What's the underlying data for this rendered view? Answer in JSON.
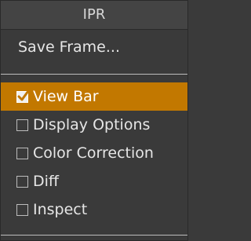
{
  "menu": {
    "title": "IPR",
    "action": "Save Frame...",
    "items": [
      {
        "label": "View Bar",
        "checked": true,
        "highlighted": true
      },
      {
        "label": "Display Options",
        "checked": false,
        "highlighted": false
      },
      {
        "label": "Color Correction",
        "checked": false,
        "highlighted": false
      },
      {
        "label": "Diff",
        "checked": false,
        "highlighted": false
      },
      {
        "label": "Inspect",
        "checked": false,
        "highlighted": false
      }
    ]
  },
  "colors": {
    "background": "#3a3a3a",
    "highlight": "#c27800",
    "text": "#e6e6e6"
  }
}
